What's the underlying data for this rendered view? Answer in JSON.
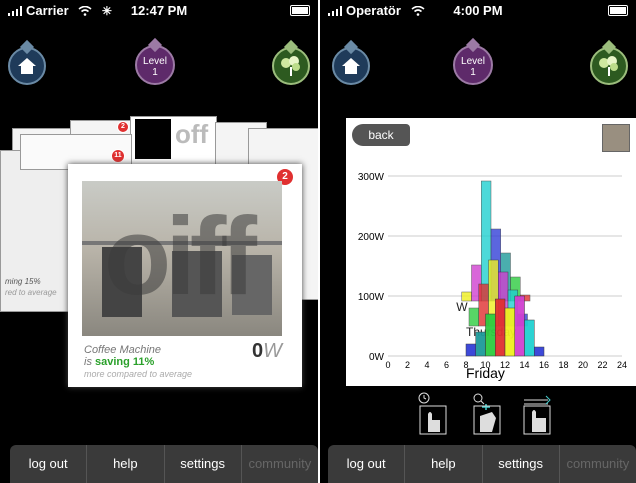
{
  "left": {
    "status": {
      "carrier": "Carrier",
      "time": "12:47 PM"
    },
    "level": {
      "label": "Level",
      "value": "1"
    },
    "card": {
      "badge": "2",
      "overlay": "oiff",
      "title": "Coffee Machine",
      "status_prefix": "is ",
      "status_value": "saving 11%",
      "subtitle": "more compared to average",
      "watts_value": "0",
      "watts_unit": "W"
    },
    "back_cards": {
      "badge_a": "11",
      "badge_b": "2",
      "side_line1": "ming 15%",
      "side_line2": "red to average",
      "overlay_small": "off"
    },
    "tabs": [
      "log out",
      "help",
      "settings",
      "community"
    ]
  },
  "right": {
    "status": {
      "carrier": "Operatör",
      "time": "4:00 PM"
    },
    "level": {
      "label": "Level",
      "value": "1"
    },
    "back_label": "back",
    "tabs": [
      "log out",
      "help",
      "settings",
      "community"
    ]
  },
  "chart_data": {
    "type": "bar",
    "title": "",
    "ylabel": "",
    "yticks": [
      "300W",
      "200W",
      "100W",
      "0W"
    ],
    "ylim": [
      0,
      350
    ],
    "xticks": [
      "0",
      "2",
      "4",
      "6",
      "8",
      "10",
      "12",
      "14",
      "16",
      "18",
      "20",
      "22",
      "24"
    ],
    "days": [
      {
        "name": "Friday",
        "hours": [
          8,
          9,
          10,
          11,
          12,
          13,
          14,
          15
        ],
        "values": [
          20,
          40,
          70,
          95,
          80,
          100,
          60,
          15
        ]
      },
      {
        "name": "Thursday",
        "hours": [
          8,
          9,
          10,
          11,
          12,
          13
        ],
        "values": [
          30,
          70,
          110,
          90,
          60,
          20
        ]
      },
      {
        "name": "W",
        "hours": [
          7,
          8,
          9,
          10,
          11,
          12,
          13
        ],
        "values": [
          15,
          60,
          200,
          120,
          80,
          40,
          10
        ]
      }
    ],
    "series_colors": [
      "#3340d8",
      "#1d9a9a",
      "#2ecc40",
      "#e03030",
      "#f0f020",
      "#d040d0",
      "#20d0d0"
    ]
  },
  "colors": {
    "saving": "#2aa02a",
    "badge": "#e03030",
    "level": "#5e2a6a"
  }
}
